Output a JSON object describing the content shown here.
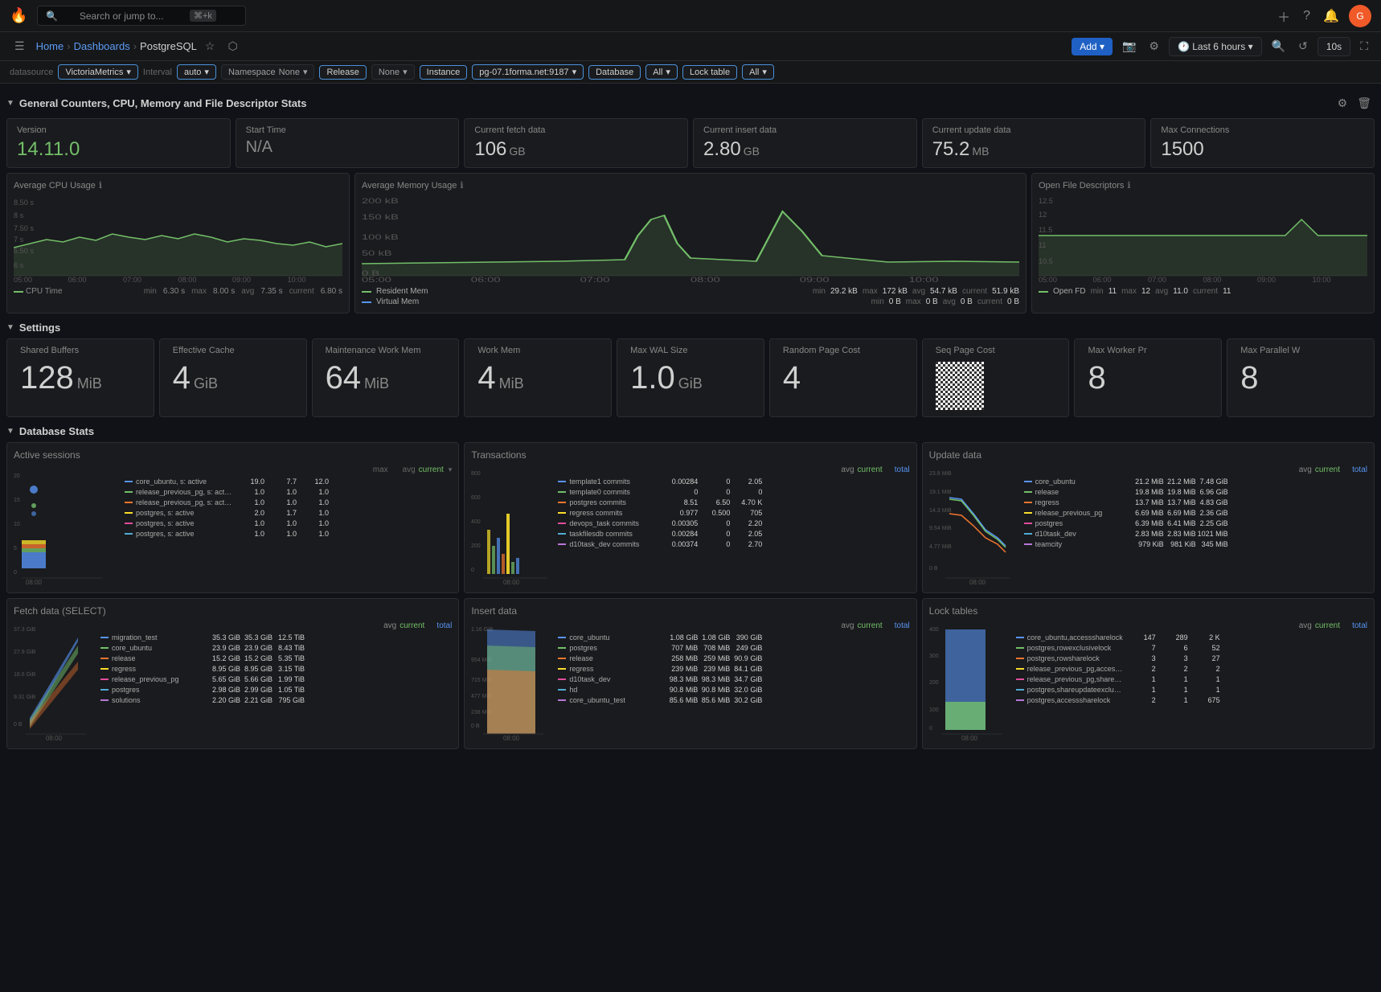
{
  "app": {
    "logo": "🔥",
    "search_placeholder": "Search or jump to...",
    "search_shortcut": "⌘+k"
  },
  "nav": {
    "home": "Home",
    "dashboards": "Dashboards",
    "current": "PostgreSQL",
    "add_label": "Add",
    "time_label": "Last 6 hours",
    "refresh_interval": "10s"
  },
  "filters": {
    "datasource_label": "datasource",
    "datasource_value": "VictoriaMetrics",
    "interval_label": "Interval",
    "interval_value": "auto",
    "namespace_label": "Namespace",
    "namespace_value": "None",
    "release_label": "Release",
    "release_value": "None",
    "instance_label": "Instance",
    "instance_value": "pg-07.1forma.net:9187",
    "database_label": "Database",
    "database_value": "All",
    "lock_table_label": "Lock table",
    "lock_table_value": "All"
  },
  "section1": {
    "title": "General Counters, CPU, Memory and File Descriptor Stats"
  },
  "stats": {
    "version_label": "Version",
    "version_value": "14.11.0",
    "start_time_label": "Start Time",
    "start_time_value": "N/A",
    "fetch_label": "Current fetch data",
    "fetch_value": "106",
    "fetch_unit": "GB",
    "insert_label": "Current insert data",
    "insert_value": "2.80",
    "insert_unit": "GB",
    "update_label": "Current update data",
    "update_value": "75.2",
    "update_unit": "MB",
    "maxconn_label": "Max Connections",
    "maxconn_value": "1500"
  },
  "cpu_chart": {
    "title": "Average CPU Usage",
    "legend_label": "CPU Time",
    "min": "6.30 s",
    "max": "8.00 s",
    "avg": "7.35 s",
    "current": "6.80 s",
    "times": [
      "05:00",
      "06:00",
      "07:00",
      "08:00",
      "09:00",
      "10:00"
    ]
  },
  "mem_chart": {
    "title": "Average Memory Usage",
    "times": [
      "05:00",
      "06:00",
      "07:00",
      "08:00",
      "09:00",
      "10:00"
    ],
    "y_labels": [
      "0 B",
      "50 kB",
      "100 kB",
      "150 kB",
      "200 kB"
    ],
    "resident_min": "29.2 kB",
    "resident_max": "172 kB",
    "resident_avg": "54.7 kB",
    "resident_current": "51.9 kB",
    "virtual_min": "0 B",
    "virtual_max": "0 B",
    "virtual_avg": "0 B",
    "virtual_current": "0 B"
  },
  "fd_chart": {
    "title": "Open File Descriptors",
    "times": [
      "05:00",
      "06:00",
      "07:00",
      "08:00",
      "09:00",
      "10:00"
    ],
    "y_labels": [
      "10.5",
      "11",
      "11.5",
      "12",
      "12.5"
    ],
    "open_min": "11",
    "open_max": "12",
    "open_avg": "11.0",
    "open_current": "11"
  },
  "section2": {
    "title": "Settings"
  },
  "settings": {
    "shared_buffers_label": "Shared Buffers",
    "shared_buffers_value": "128",
    "shared_buffers_unit": "MiB",
    "effective_cache_label": "Effective Cache",
    "effective_cache_value": "4",
    "effective_cache_unit": "GiB",
    "maintenance_label": "Maintenance Work Mem",
    "maintenance_value": "64",
    "maintenance_unit": "MiB",
    "work_mem_label": "Work Mem",
    "work_mem_value": "4",
    "work_mem_unit": "MiB",
    "wal_size_label": "Max WAL Size",
    "wal_size_value": "1.0",
    "wal_size_unit": "GiB",
    "random_page_label": "Random Page Cost",
    "random_page_value": "4",
    "seq_page_label": "Seq Page Cost",
    "max_worker_label": "Max Worker Pr",
    "max_worker_value": "8",
    "max_parallel_label": "Max Parallel W",
    "max_parallel_value": "8"
  },
  "section3": {
    "title": "Database Stats"
  },
  "active_sessions": {
    "title": "Active sessions",
    "header": [
      "max",
      "avg",
      "current"
    ],
    "rows": [
      {
        "color": "#5794f2",
        "name": "core_ubuntu, s: active",
        "max": "19.0",
        "avg": "7.7",
        "current": "12.0"
      },
      {
        "color": "#73bf69",
        "name": "release_previous_pg, s: active",
        "max": "1.0",
        "avg": "1.0",
        "current": "1.0"
      },
      {
        "color": "#f2762e",
        "name": "release_previous_pg, s: active",
        "max": "1.0",
        "avg": "1.0",
        "current": "1.0"
      },
      {
        "color": "#fade2a",
        "name": "postgres, s: active",
        "max": "2.0",
        "avg": "1.7",
        "current": "1.0"
      },
      {
        "color": "#e04d9c",
        "name": "postgres, s: active",
        "max": "1.0",
        "avg": "1.0",
        "current": "1.0"
      },
      {
        "color": "#50acd3",
        "name": "postgres, s: active",
        "max": "1.0",
        "avg": "1.0",
        "current": "1.0"
      }
    ]
  },
  "transactions": {
    "title": "Transactions",
    "header": [
      "avg",
      "current",
      "total"
    ],
    "rows": [
      {
        "color": "#5794f2",
        "name": "template1 commits",
        "avg": "0.00284",
        "current": "0",
        "total": "2.05"
      },
      {
        "color": "#73bf69",
        "name": "template0 commits",
        "avg": "0",
        "current": "0",
        "total": "0"
      },
      {
        "color": "#f2762e",
        "name": "postgres commits",
        "avg": "8.51",
        "current": "6.50",
        "total": "4.70 K"
      },
      {
        "color": "#fade2a",
        "name": "regress commits",
        "avg": "0.977",
        "current": "0.500",
        "total": "705"
      },
      {
        "color": "#e04d9c",
        "name": "devops_task commits",
        "avg": "0.00305",
        "current": "0",
        "total": "2.20"
      },
      {
        "color": "#50acd3",
        "name": "taskfilesdb commits",
        "avg": "0.00284",
        "current": "0",
        "total": "2.05"
      },
      {
        "color": "#b877d9",
        "name": "d10task_dev commits",
        "avg": "0.00374",
        "current": "0",
        "total": "2.70"
      }
    ]
  },
  "update_data": {
    "title": "Update data",
    "header": [
      "avg",
      "current",
      "total"
    ],
    "y_labels": [
      "0 B",
      "4.77 MiB",
      "9.54 MiB",
      "14.3 MiB",
      "19.1 MiB",
      "23.8 MiB"
    ],
    "rows": [
      {
        "color": "#5794f2",
        "name": "core_ubuntu",
        "avg": "21.2 MiB",
        "current": "21.2 MiB",
        "total": "7.48 GiB"
      },
      {
        "color": "#73bf69",
        "name": "release",
        "avg": "19.8 MiB",
        "current": "19.8 MiB",
        "total": "6.96 GiB"
      },
      {
        "color": "#f2762e",
        "name": "regress",
        "avg": "13.7 MiB",
        "current": "13.7 MiB",
        "total": "4.83 GiB"
      },
      {
        "color": "#fade2a",
        "name": "release_previous_pg",
        "avg": "6.69 MiB",
        "current": "6.69 MiB",
        "total": "2.36 GiB"
      },
      {
        "color": "#e04d9c",
        "name": "postgres",
        "avg": "6.39 MiB",
        "current": "6.41 MiB",
        "total": "2.25 GiB"
      },
      {
        "color": "#50acd3",
        "name": "d10task_dev",
        "avg": "2.83 MiB",
        "current": "2.83 MiB",
        "total": "1021 MiB"
      },
      {
        "color": "#b877d9",
        "name": "teamcity",
        "avg": "979 KiB",
        "current": "981 KiB",
        "total": "345 MiB"
      }
    ]
  },
  "fetch_data": {
    "title": "Fetch data (SELECT)",
    "y_labels": [
      "0 B",
      "9.31 GiB",
      "18.6 GiB",
      "27.9 GiB",
      "37.3 GiB"
    ],
    "header": [
      "avg",
      "current",
      "total"
    ],
    "rows": [
      {
        "color": "#5794f2",
        "name": "migration_test",
        "avg": "35.3 GiB",
        "current": "35.3 GiB",
        "total": "12.5 TiB"
      },
      {
        "color": "#73bf69",
        "name": "core_ubuntu",
        "avg": "23.9 GiB",
        "current": "23.9 GiB",
        "total": "8.43 TiB"
      },
      {
        "color": "#f2762e",
        "name": "release",
        "avg": "15.2 GiB",
        "current": "15.2 GiB",
        "total": "5.35 TiB"
      },
      {
        "color": "#fade2a",
        "name": "regress",
        "avg": "8.95 GiB",
        "current": "8.95 GiB",
        "total": "3.15 TiB"
      },
      {
        "color": "#e04d9c",
        "name": "release_previous_pg",
        "avg": "5.65 GiB",
        "current": "5.66 GiB",
        "total": "1.99 TiB"
      },
      {
        "color": "#50acd3",
        "name": "postgres",
        "avg": "2.98 GiB",
        "current": "2.99 GiB",
        "total": "1.05 TiB"
      },
      {
        "color": "#b877d9",
        "name": "solutions",
        "avg": "2.20 GiB",
        "current": "2.21 GiB",
        "total": "795 GiB"
      }
    ]
  },
  "insert_data": {
    "title": "Insert data",
    "y_max": "1.16 GiB",
    "header": [
      "avg",
      "current",
      "total"
    ],
    "rows": [
      {
        "color": "#5794f2",
        "name": "core_ubuntu",
        "avg": "1.08 GiB",
        "current": "1.08 GiB",
        "total": "390 GiB"
      },
      {
        "color": "#73bf69",
        "name": "postgres",
        "avg": "707 MiB",
        "current": "708 MiB",
        "total": "249 GiB"
      },
      {
        "color": "#f2762e",
        "name": "release",
        "avg": "258 MiB",
        "current": "259 MiB",
        "total": "90.9 GiB"
      },
      {
        "color": "#fade2a",
        "name": "regress",
        "avg": "239 MiB",
        "current": "239 MiB",
        "total": "84.1 GiB"
      },
      {
        "color": "#e04d9c",
        "name": "d10task_dev",
        "avg": "98.3 MiB",
        "current": "98.3 MiB",
        "total": "34.7 GiB"
      },
      {
        "color": "#50acd3",
        "name": "hd",
        "avg": "90.8 MiB",
        "current": "90.8 MiB",
        "total": "32.0 GiB"
      },
      {
        "color": "#b877d9",
        "name": "core_ubuntu_test",
        "avg": "85.6 MiB",
        "current": "85.6 MiB",
        "total": "30.2 GiB"
      }
    ]
  },
  "lock_tables": {
    "title": "Lock tables",
    "y_labels": [
      "0",
      "100",
      "200",
      "300",
      "400"
    ],
    "header": [
      "avg",
      "current",
      "total"
    ],
    "rows": [
      {
        "color": "#5794f2",
        "name": "core_ubuntu,accesssharelock",
        "avg": "147",
        "current": "289",
        "total": "2 K"
      },
      {
        "color": "#73bf69",
        "name": "postgres,rowexclusivelock",
        "avg": "7",
        "current": "6",
        "total": "52"
      },
      {
        "color": "#f2762e",
        "name": "postgres,rowsharelock",
        "avg": "3",
        "current": "3",
        "total": "27"
      },
      {
        "color": "#fade2a",
        "name": "release_previous_pg,accesssharelock",
        "avg": "2",
        "current": "2",
        "total": "2"
      },
      {
        "color": "#e04d9c",
        "name": "release_previous_pg,shareupdateexclusivelock",
        "avg": "1",
        "current": "1",
        "total": "1"
      },
      {
        "color": "#50acd3",
        "name": "postgres,shareupdateexclusivelock",
        "avg": "1",
        "current": "1",
        "total": "1"
      },
      {
        "color": "#b877d9",
        "name": "postgres,accesssharelock",
        "avg": "2",
        "current": "1",
        "total": "675"
      }
    ]
  }
}
